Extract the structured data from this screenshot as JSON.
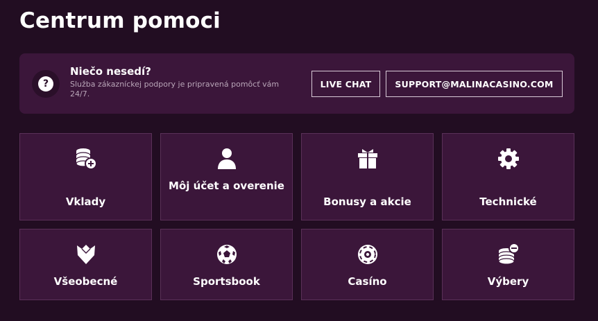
{
  "page": {
    "title": "Centrum pomoci"
  },
  "support": {
    "heading": "Niečo nesedí?",
    "text": "Služba zákazníckej podpory je pripravená pomôcť vám 24/7.",
    "help_icon": "question-mark-icon",
    "live_chat_label": "LIVE CHAT",
    "email_label": "SUPPORT@MALINACASINO.COM"
  },
  "categories": [
    {
      "label": "Vklady",
      "icon": "coins-plus-icon"
    },
    {
      "label": "Môj účet a overenie",
      "icon": "user-icon"
    },
    {
      "label": "Bonusy a akcie",
      "icon": "gift-icon"
    },
    {
      "label": "Technické",
      "icon": "gear-icon"
    },
    {
      "label": "Všeobecné",
      "icon": "raspberry-icon"
    },
    {
      "label": "Sportsbook",
      "icon": "soccer-ball-icon"
    },
    {
      "label": "Casíno",
      "icon": "casino-chip-icon"
    },
    {
      "label": "Výbery",
      "icon": "coins-minus-icon"
    }
  ],
  "colors": {
    "background": "#220d22",
    "panel": "#3b163a",
    "border": "#5a3058",
    "text": "#ffffff",
    "muted_text": "#b9a6b8"
  }
}
